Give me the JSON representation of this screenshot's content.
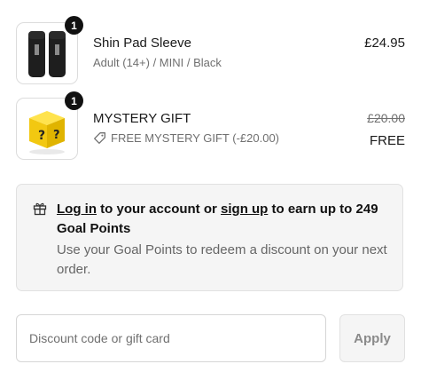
{
  "items": [
    {
      "name": "Shin Pad Sleeve",
      "variant": "Adult (14+) / MINI / Black",
      "price": "£24.95",
      "quantity": "1",
      "image_icon": "shin-pad-sleeve-image"
    },
    {
      "name": "MYSTERY GIFT",
      "discount_label": "FREE MYSTERY GIFT (-£20.00)",
      "original_price": "£20.00",
      "price": "FREE",
      "quantity": "1",
      "image_icon": "mystery-box-image"
    }
  ],
  "points_banner": {
    "login_link": "Log in",
    "text_1": " to your account or ",
    "signup_link": "sign up",
    "text_2": " to earn up to 249 Goal Points",
    "subtext": "Use your Goal Points to redeem a discount on your next order."
  },
  "discount": {
    "placeholder": "Discount code or gift card",
    "apply_label": "Apply"
  },
  "colors": {
    "badge": "#111111",
    "box_background": "#f5f5f5",
    "muted_text": "#707070",
    "mystery_yellow": "#f5d31a"
  }
}
